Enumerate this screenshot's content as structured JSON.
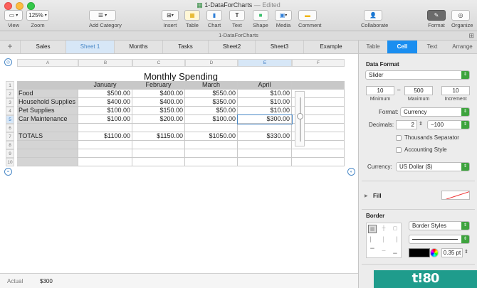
{
  "window": {
    "doc_name": "1-DataForCharts",
    "edited": "— Edited",
    "subtitle": "1-DataForCharts"
  },
  "toolbar": {
    "view": "View",
    "zoom_value": "125%",
    "zoom": "Zoom",
    "add_category": "Add Category",
    "insert": "Insert",
    "table": "Table",
    "chart": "Chart",
    "text": "Text",
    "shape": "Shape",
    "media": "Media",
    "comment": "Comment",
    "collaborate": "Collaborate",
    "format": "Format",
    "organize": "Organize"
  },
  "tabs": [
    "Sales",
    "Sheet 1",
    "Months",
    "Tasks",
    "Sheet2",
    "Sheet3",
    "Example"
  ],
  "active_tab": "Sheet 1",
  "columns": [
    "A",
    "B",
    "C",
    "D",
    "E",
    "F"
  ],
  "rows": [
    "1",
    "2",
    "3",
    "4",
    "5",
    "6",
    "7",
    "8",
    "9",
    "10"
  ],
  "table": {
    "title": "Monthly Spending",
    "headers": [
      "",
      "January",
      "February",
      "March",
      "April"
    ],
    "rows": [
      [
        "Food",
        "$500.00",
        "$400.00",
        "$550.00",
        "$10.00"
      ],
      [
        "Household Supplies",
        "$400.00",
        "$400.00",
        "$350.00",
        "$10.00"
      ],
      [
        "Pet Supplies",
        "$100.00",
        "$150.00",
        "$50.00",
        "$10.00"
      ],
      [
        "Car Maintenance",
        "$100.00",
        "$200.00",
        "$100.00",
        "$300.00"
      ],
      [
        "",
        "",
        "",
        "",
        ""
      ],
      [
        "TOTALS",
        "$1100.00",
        "$1150.00",
        "$1050.00",
        "$330.00"
      ],
      [
        "",
        "",
        "",
        "",
        ""
      ],
      [
        "",
        "",
        "",
        "",
        ""
      ],
      [
        "",
        "",
        "",
        "",
        ""
      ]
    ]
  },
  "status": {
    "label": "Actual",
    "value": "$300"
  },
  "inspector": {
    "tabs": [
      "Table",
      "Cell",
      "Text",
      "Arrange"
    ],
    "active_tab": "Cell",
    "data_format_title": "Data Format",
    "data_format": "Slider",
    "minimum_value": "10",
    "maximum_value": "500",
    "increment_value": "10",
    "minimum_label": "Minimum",
    "maximum_label": "Maximum",
    "increment_label": "Increment",
    "range_dash": "–",
    "format_label": "Format:",
    "format_value": "Currency",
    "decimals_label": "Decimals:",
    "decimals_value": "2",
    "negative_value": "−100",
    "thousands_separator": "Thousands Separator",
    "accounting_style": "Accounting Style",
    "currency_label": "Currency:",
    "currency_value": "US Dollar ($)",
    "fill_title": "Fill",
    "border_title": "Border",
    "border_styles": "Border Styles",
    "border_width": "0.35 pt",
    "partial_button": "C"
  },
  "brand": "t!80"
}
